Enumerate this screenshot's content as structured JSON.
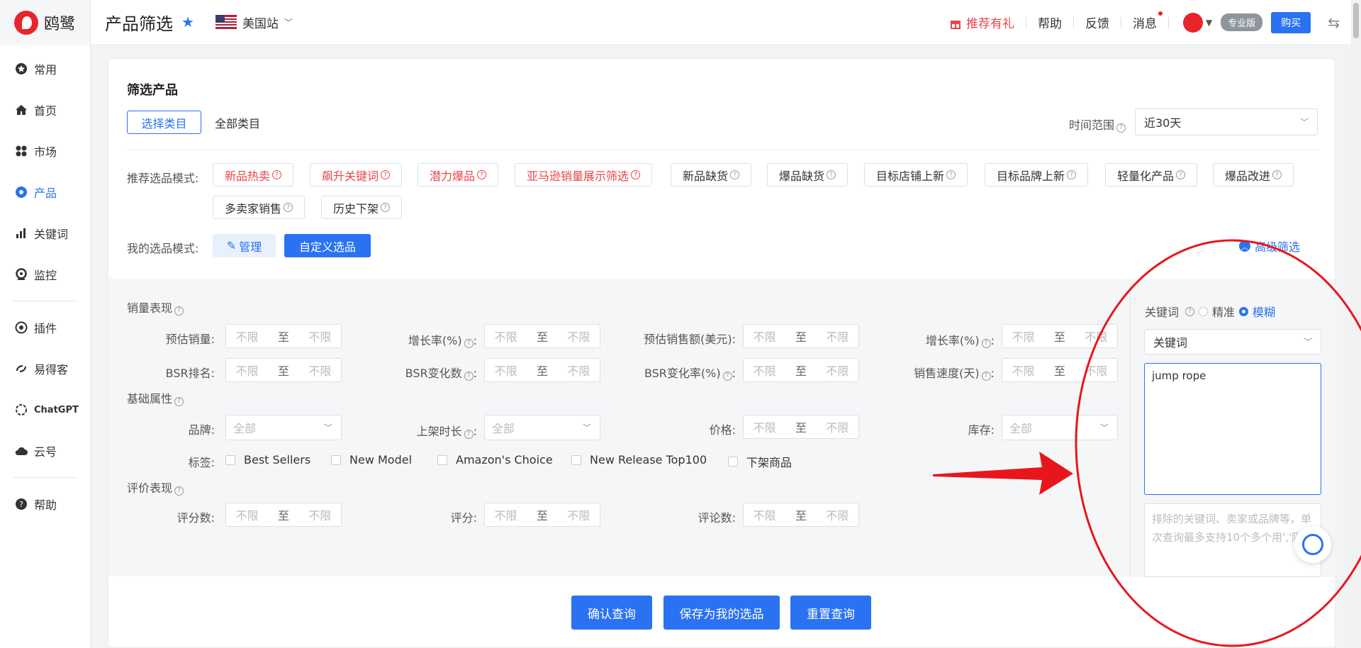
{
  "brand": {
    "name": "鸥鹭"
  },
  "sidebar": {
    "items": [
      {
        "label": "常用",
        "icon": "star-badge-icon"
      },
      {
        "label": "首页",
        "icon": "home-icon"
      },
      {
        "label": "市场",
        "icon": "grid-icon"
      },
      {
        "label": "产品",
        "icon": "eye-icon"
      },
      {
        "label": "关键词",
        "icon": "bar-chart-icon"
      },
      {
        "label": "监控",
        "icon": "camera-icon"
      },
      {
        "label": "插件",
        "icon": "chrome-icon"
      },
      {
        "label": "易得客",
        "icon": "link-icon"
      },
      {
        "label": "ChatGPT",
        "icon": "openai-icon"
      },
      {
        "label": "云号",
        "icon": "cloud-icon"
      },
      {
        "label": "帮助",
        "icon": "help-icon"
      }
    ],
    "active": "产品"
  },
  "topbar": {
    "title": "产品筛选",
    "site": "美国站",
    "recommend": "推荐有礼",
    "help": "帮助",
    "feedback": "反馈",
    "messages": "消息",
    "pro_badge": "专业版",
    "buy": "购买"
  },
  "card": {
    "title": "筛选产品",
    "tab_active": "选择类目",
    "tab_all": "全部类目",
    "time_range_label": "时间范围",
    "time_range_value": "近30天",
    "recommend_label": "推荐选品模式:",
    "recommend_modes": [
      {
        "label": "新品热卖",
        "red": true
      },
      {
        "label": "飙升关键词",
        "red": true
      },
      {
        "label": "潜力爆品",
        "red": true
      },
      {
        "label": "亚马逊销量展示筛选",
        "red": true
      },
      {
        "label": "新品缺货",
        "red": false
      },
      {
        "label": "爆品缺货",
        "red": false
      },
      {
        "label": "目标店铺上新",
        "red": false
      },
      {
        "label": "目标品牌上新",
        "red": false
      },
      {
        "label": "轻量化产品",
        "red": false
      },
      {
        "label": "爆品改进",
        "red": false
      },
      {
        "label": "多卖家销售",
        "red": false
      },
      {
        "label": "历史下架",
        "red": false
      }
    ],
    "my_modes_label": "我的选品模式:",
    "manage": "管理",
    "custom": "自定义选品",
    "advanced": "高级筛选"
  },
  "filters": {
    "sales_section": "销量表现",
    "basic_section": "基础属性",
    "review_section": "评价表现",
    "range_from": "不限",
    "range_to_word": "至",
    "range_to": "不限",
    "all": "全部",
    "labels": {
      "est_sales": "预估销量:",
      "growth": "增长率(%)",
      "est_revenue": "预估销售额(美元)",
      "growth2": "增长率(%)",
      "bsr": "BSR排名:",
      "bsr_change": "BSR变化数",
      "bsr_change_rate": "BSR变化率(%)",
      "sales_speed": "销售速度(天)",
      "brand": "品牌:",
      "listing_age": "上架时长",
      "price": "价格:",
      "stock": "库存:",
      "tags": "标签:",
      "rating_count": "评分数:",
      "rating": "评分:",
      "review_count": "评论数:"
    },
    "tags": [
      "Best Sellers",
      "New Model",
      "Amazon's Choice",
      "New Release Top100",
      "下架商品"
    ]
  },
  "keyword_panel": {
    "label": "关键词",
    "exact": "精准",
    "fuzzy": "模糊",
    "match_mode": "fuzzy",
    "type_value": "关键词",
    "keywords": "jump rope",
    "exclude_placeholder": "排除的关键词、卖家或品牌等，单次查询最多支持10个多个用','隔开"
  },
  "buttons": {
    "confirm": "确认查询",
    "save": "保存为我的选品",
    "reset": "重置查询"
  },
  "colors": {
    "accent": "#2a72f2",
    "brand_red": "#e8252b",
    "annotation": "#e8161c"
  }
}
